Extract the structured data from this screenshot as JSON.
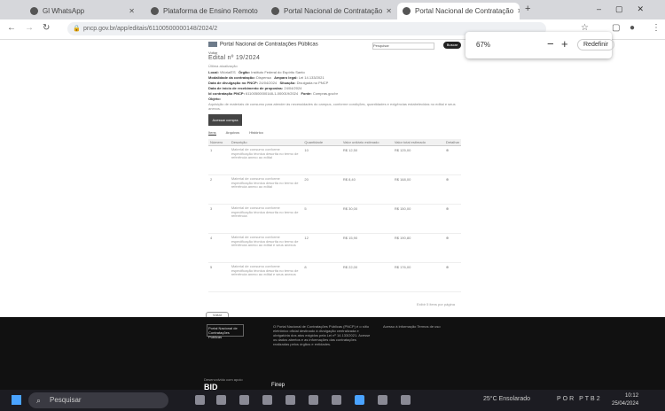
{
  "browser": {
    "tabs": [
      {
        "label": "Gl WhatsApp",
        "active": false
      },
      {
        "label": "Plataforma de Ensino Remoto",
        "active": false
      },
      {
        "label": "Portal Nacional de Contratação",
        "active": false
      },
      {
        "label": "Portal Nacional de Contratação",
        "active": true
      }
    ],
    "new_tab": "+",
    "url": "pncp.gov.br/app/editais/61100500000148/2024/2",
    "zoom": {
      "value": "67%",
      "minus": "−",
      "plus": "+",
      "reset": "Redefinir"
    }
  },
  "page": {
    "logo_text": "Portal Nacional de Contratações Públicas",
    "search_placeholder": "Pesquisar",
    "search_button": "Buscar",
    "back": "Voltar",
    "title": "Edital nº 19/2024",
    "subtitle": "Última atualização",
    "fields": [
      {
        "label": "Local:",
        "value": "Vitória/ES",
        "label2": "Órgão:",
        "value2": "Instituto Federal do Espírito Santo"
      },
      {
        "label": "Modalidade da contratação:",
        "value": "Dispensa",
        "label2": "Amparo legal:",
        "value2": "Lei 14.133/2021"
      },
      {
        "label": "Data de divulgação no PNCP:",
        "value": "24/04/2024",
        "label2": "Situação:",
        "value2": "Divulgada no PNCP"
      },
      {
        "label": "Data de início de recebimento de propostas:",
        "value": "24/04/2024"
      },
      {
        "label": "Id contratação PNCP:",
        "value": "61100500000148-1-000019/2024",
        "label2": "Fonte:",
        "value2": "Compras.gov.br"
      },
      {
        "label": "Objeto:",
        "value": ""
      }
    ],
    "description": "Aquisição de materiais de consumo para atender às necessidades do campus, conforme condições, quantidades e exigências estabelecidas no edital e seus anexos.",
    "action_button": "Acessar compra",
    "tabs": [
      "Itens",
      "Arquivos",
      "Histórico"
    ],
    "table": {
      "headers": [
        "Número",
        "Descrição",
        "Quantidade",
        "Valor unitário estimado",
        "Valor total estimado",
        "Detalhar"
      ],
      "rows": [
        {
          "num": "1",
          "desc": "Material de consumo conforme especificação técnica descrita no termo de referência anexo ao edital",
          "qty": "10",
          "unit": "R$ 12,50",
          "total": "R$ 125,00",
          "detail": "⊕"
        },
        {
          "num": "2",
          "desc": "Material de consumo conforme especificação técnica descrita no termo de referência anexo ao edital",
          "qty": "20",
          "unit": "R$ 8,40",
          "total": "R$ 168,00",
          "detail": "⊕"
        },
        {
          "num": "3",
          "desc": "Material de consumo conforme especificação técnica descrita no termo de referência",
          "qty": "5",
          "unit": "R$ 30,00",
          "total": "R$ 150,00",
          "detail": "⊕"
        },
        {
          "num": "4",
          "desc": "Material de consumo conforme especificação técnica descrita no termo de referência anexo ao edital e seus anexos",
          "qty": "12",
          "unit": "R$ 15,90",
          "total": "R$ 190,80",
          "detail": "⊕"
        },
        {
          "num": "5",
          "desc": "Material de consumo conforme especificação técnica descrita no termo de referência anexo ao edital e seus anexos",
          "qty": "8",
          "unit": "R$ 22,00",
          "total": "R$ 176,00",
          "detail": "⊕"
        }
      ]
    },
    "pager": "Exibir 5 itens por página",
    "back_pill": "Voltar"
  },
  "footer": {
    "logo": "Portal Nacional de Contratações Públicas",
    "col1": "O Portal Nacional de Contratações Públicas (PNCP) é o sítio eletrônico oficial destinado à divulgação centralizada e obrigatória dos atos exigidos pela Lei nº 14.133/2021. Acesse os dados abertos e as informações das contratações realizadas pelos órgãos e entidades.",
    "col2": "Acesso à informação Termos de uso",
    "sponsor_label": "Desenvolvido com apoio",
    "bid": "BID",
    "finep": "Finep"
  },
  "taskbar": {
    "search": "Pesquisar",
    "weather": "25°C  Ensolarado",
    "lang": "POR PTB2",
    "time": "10:12",
    "date": "25/04/2024"
  }
}
